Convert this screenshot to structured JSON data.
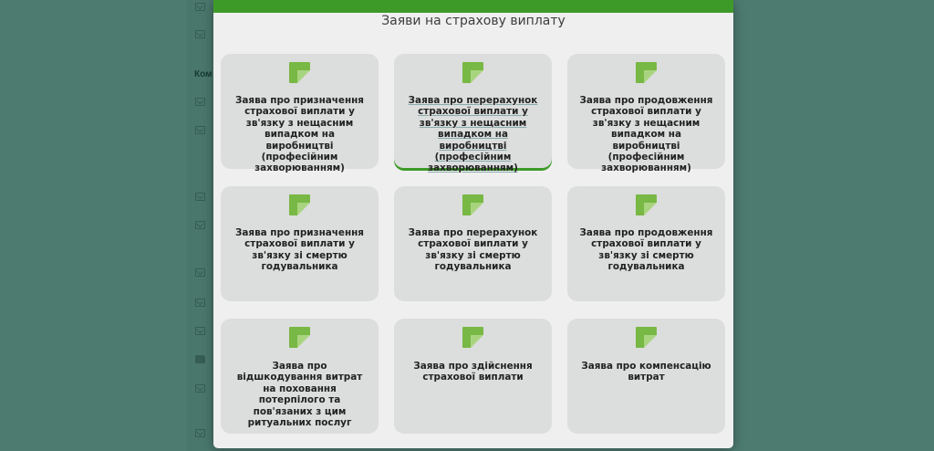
{
  "background": {
    "section_label": "Ком"
  },
  "modal": {
    "title": "Заяви на страхову виплату",
    "accent_color": "#3d9a28",
    "icon_color": "#78b844",
    "cards": [
      {
        "label": "Заява про призначення страхової виплати у зв'язку з нещасним випадком на виробництві (професійним захворюванням)",
        "icon": "document-icon"
      },
      {
        "label": "Заява про перерахунок страхової виплати у зв'язку з нещасним випадком на виробництві (професійним захворюванням)",
        "icon": "document-icon",
        "hovered": true
      },
      {
        "label": "Заява про продовження страхової виплати у зв'язку з нещасним випадком на виробництві (професійним захворюванням)",
        "icon": "document-icon"
      },
      {
        "label": "Заява про призначення страхової виплати у зв'язку зі смертю годувальника",
        "icon": "document-icon"
      },
      {
        "label": "Заява про перерахунок страхової виплати у зв'язку зі смертю годувальника",
        "icon": "document-icon"
      },
      {
        "label": "Заява про продовження страхової виплати у зв'язку зі смертю годувальника",
        "icon": "document-icon"
      },
      {
        "label": "Заява про відшкодування витрат на поховання потерпілого та пов'язаних з цим ритуальних послуг",
        "icon": "document-icon"
      },
      {
        "label": "Заява про здійснення страхової виплати",
        "icon": "document-icon"
      },
      {
        "label": "Заява про компенсацію витрат",
        "icon": "document-icon"
      }
    ]
  }
}
